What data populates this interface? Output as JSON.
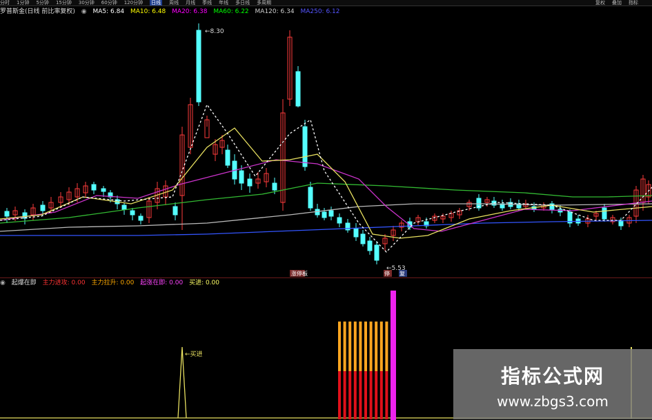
{
  "toolbar": {
    "items": [
      "分时",
      "1分钟",
      "5分钟",
      "15分钟",
      "30分钟",
      "60分钟",
      "120分钟",
      "日线",
      "周线",
      "月线",
      "季线",
      "年线",
      "多日线",
      "多周期"
    ],
    "active_index": 7,
    "right_items": [
      "复权",
      "叠加",
      "指标"
    ]
  },
  "main_info": {
    "name": "罗普斯金(日线 前比率复权)",
    "ma": [
      {
        "label": "MA5: 6.84",
        "color": "#ffffff"
      },
      {
        "label": "MA10: 6.48",
        "color": "#ffff00"
      },
      {
        "label": "MA20: 6.38",
        "color": "#ff00ff"
      },
      {
        "label": "MA60: 6.22",
        "color": "#00ff00"
      },
      {
        "label": "MA120: 6.34",
        "color": "#cccccc"
      },
      {
        "label": "MA250: 6.12",
        "color": "#3355ff"
      }
    ]
  },
  "price_labels": {
    "high": "8.30",
    "low": "5.53"
  },
  "markers": {
    "m1": "涨停板",
    "m2": "停",
    "m3": "复"
  },
  "sub_info": {
    "name": "起爆在即",
    "fields": [
      {
        "label": "主力进攻: 0.00",
        "color": "#ff3333"
      },
      {
        "label": "主力拉升: 0.00",
        "color": "#ffaa00"
      },
      {
        "label": "起涨在即: 0.00",
        "color": "#ff44ff"
      },
      {
        "label": "买进: 0.00",
        "color": "#ffff66"
      }
    ],
    "buy_label": "买进"
  },
  "watermark": {
    "title": "指标公式网",
    "url": "www.zbgs3.com"
  }
}
